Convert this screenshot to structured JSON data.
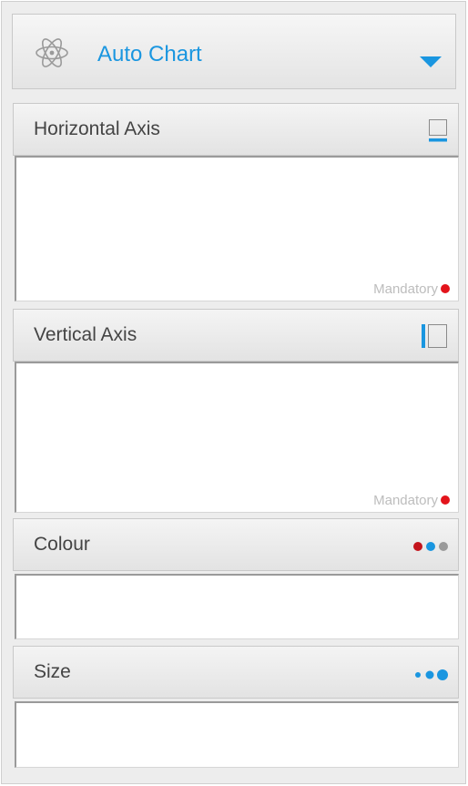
{
  "chart_selector": {
    "label": "Auto Chart",
    "icon": "atom-icon",
    "dropdown_icon": "caret-down-icon"
  },
  "sections": [
    {
      "title": "Horizontal Axis",
      "icon": "horizontal-axis-icon",
      "hint": "Mandatory"
    },
    {
      "title": "Vertical Axis",
      "icon": "vertical-axis-icon",
      "hint": "Mandatory"
    },
    {
      "title": "Colour",
      "icon": "colour-dots-icon"
    },
    {
      "title": "Size",
      "icon": "size-dots-icon"
    }
  ],
  "colors": {
    "accent": "#1a96e0",
    "mandatory_dot": "#e3141b",
    "colour_dots": [
      "#c4141c",
      "#1a96e0",
      "#9a9a9a"
    ]
  }
}
